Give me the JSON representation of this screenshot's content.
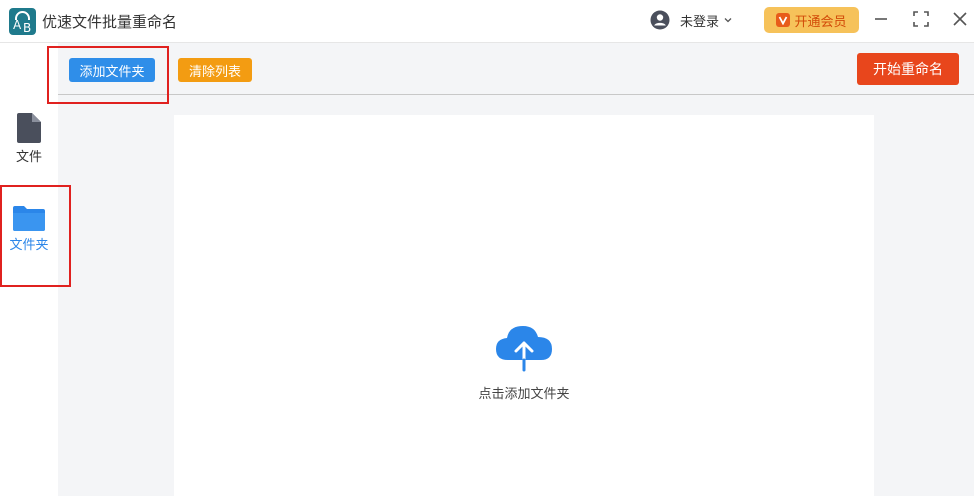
{
  "app": {
    "title": "优速文件批量重命名",
    "logo_letters": [
      "A",
      "B"
    ]
  },
  "header": {
    "user_label": "未登录",
    "vip_label": "开通会员",
    "vip_icon_letter": "V"
  },
  "sidebar": {
    "items": [
      {
        "label": "文件",
        "icon": "file-icon",
        "active": false
      },
      {
        "label": "文件夹",
        "icon": "folder-icon",
        "active": true
      }
    ]
  },
  "toolbar": {
    "add_folder_label": "添加文件夹",
    "clear_list_label": "清除列表",
    "start_label": "开始重命名"
  },
  "dropzone": {
    "hint": "点击添加文件夹",
    "icon": "cloud-upload-icon"
  },
  "colors": {
    "accent_blue": "#2f8ee9",
    "clear_orange": "#f39c12",
    "start_red": "#e8461c",
    "vip_gold": "#f6c25a",
    "highlight_red": "#e0211f"
  }
}
